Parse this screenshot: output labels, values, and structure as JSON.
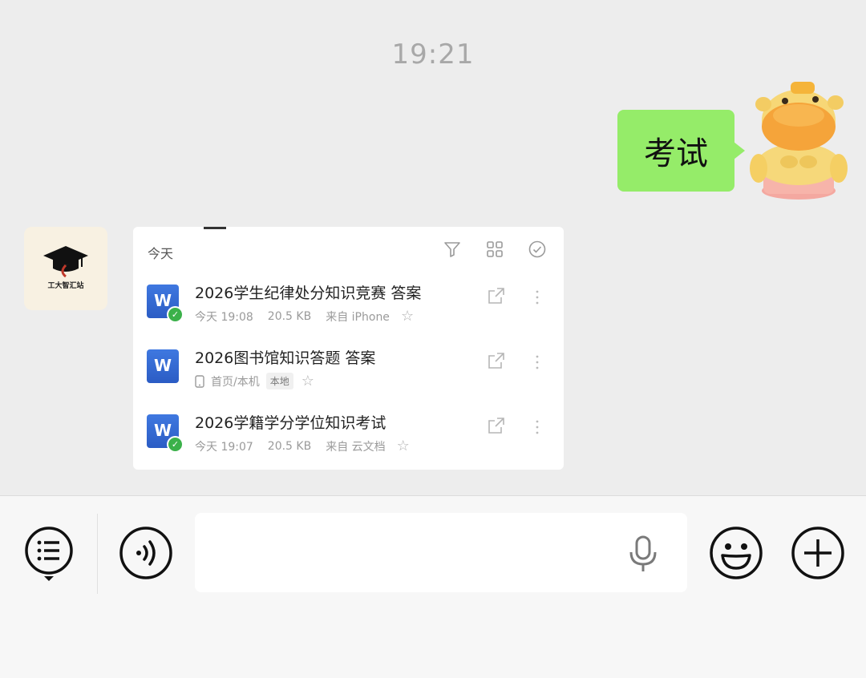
{
  "chat": {
    "timestamp": "19:21",
    "outgoing_message": "考试"
  },
  "contact": {
    "avatar_text": "工大智汇站"
  },
  "file_panel": {
    "header_label": "今天",
    "files": [
      {
        "name": "2026学生纪律处分知识竞赛 答案",
        "icon_letter": "W",
        "time": "今天 19:08",
        "size": "20.5 KB",
        "source": "来自 iPhone"
      },
      {
        "name": "2026图书馆知识答题 答案",
        "icon_letter": "W",
        "location": "首页/本机",
        "tag": "本地"
      },
      {
        "name": "2026学籍学分学位知识考试",
        "icon_letter": "W",
        "time": "今天 19:07",
        "size": "20.5 KB",
        "source": "来自 云文档"
      }
    ]
  },
  "input_bar": {
    "text_value": ""
  },
  "colors": {
    "outgoing_bubble": "#95ec69",
    "background": "#ededed",
    "word_blue": "#2b5cc4",
    "check_green": "#3bb14a"
  },
  "icons": [
    "filter-icon",
    "grid-icon",
    "check-circle-icon",
    "word-doc-icon",
    "open-external-icon",
    "more-vertical-icon",
    "star-icon",
    "phone-icon",
    "menu-list-icon",
    "voice-icon",
    "microphone-icon",
    "emoji-icon",
    "plus-icon"
  ]
}
